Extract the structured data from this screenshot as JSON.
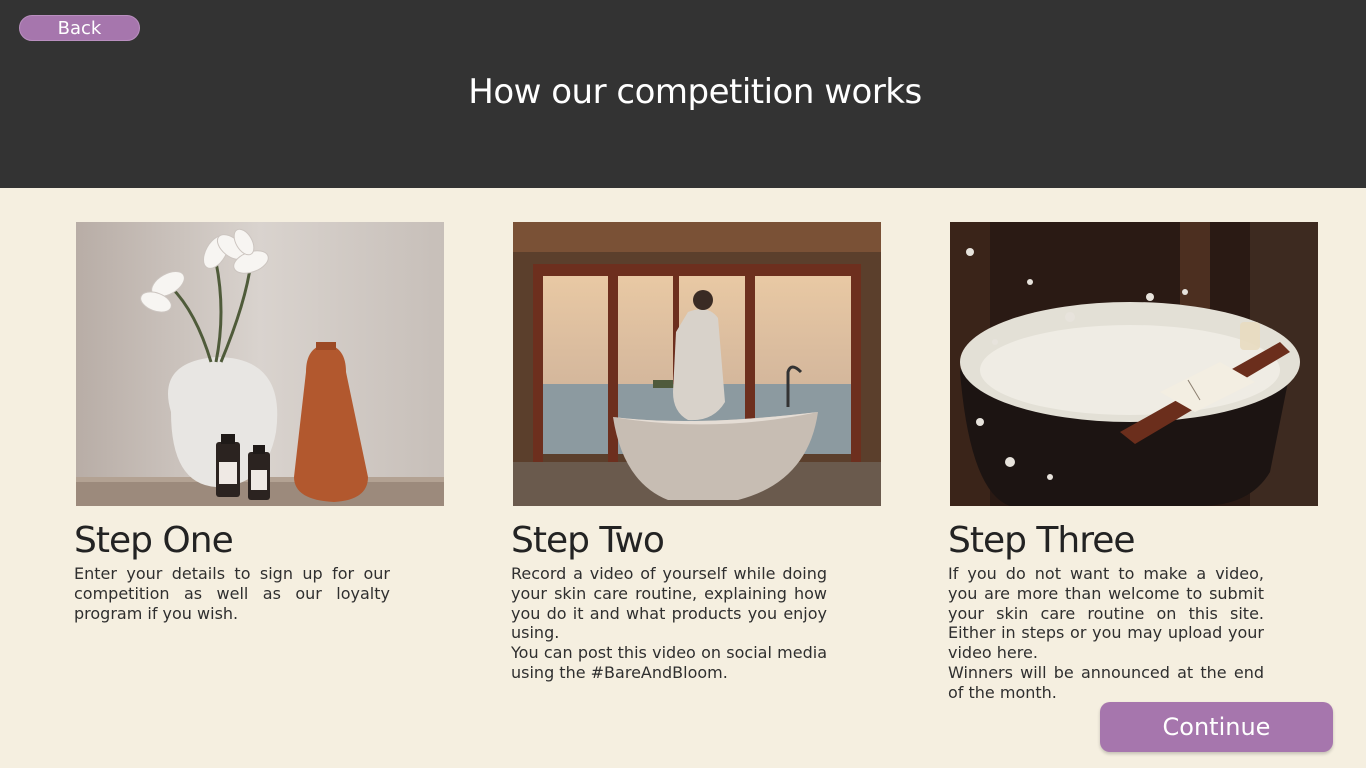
{
  "header": {
    "back_label": "Back",
    "title": "How our competition works"
  },
  "steps": [
    {
      "title": "Step One",
      "paragraphs": [
        "Enter your details to sign up for our competition as well as our loyalty program if you wish."
      ]
    },
    {
      "title": "Step Two",
      "paragraphs": [
        "Record a video of yourself while doing your skin care routine, explaining how you do it and what products you enjoy using.",
        "You can post this video on social media using the #BareAndBloom."
      ]
    },
    {
      "title": "Step Three",
      "paragraphs": [
        "If you do not want to make a video, you are more than welcome to submit your skin care routine on this site. Either in steps or you may upload your video here.",
        "Winners will be announced at the end of the month."
      ]
    }
  ],
  "footer": {
    "continue_label": "Continue"
  },
  "colors": {
    "header_bg": "#333333",
    "page_bg": "#f5efe0",
    "accent": "#a676ad"
  }
}
